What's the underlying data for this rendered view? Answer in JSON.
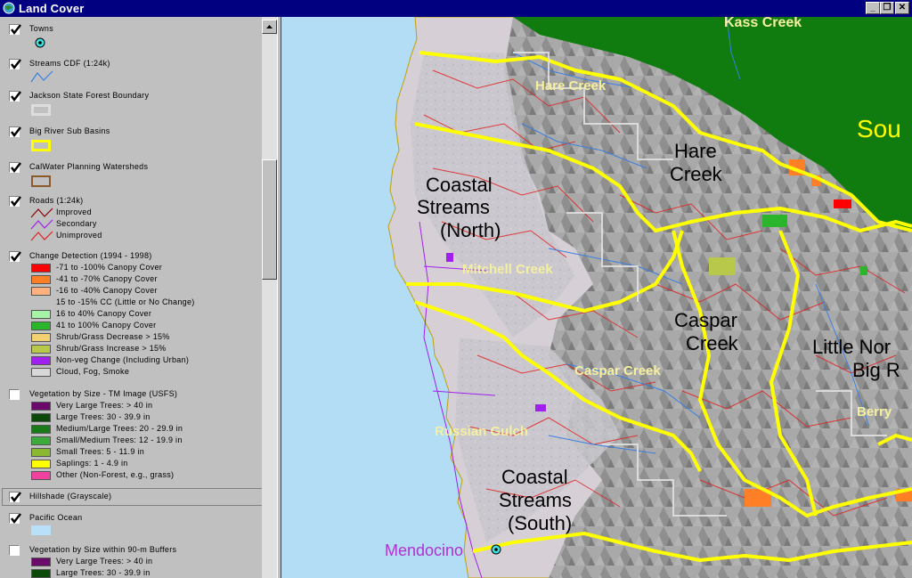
{
  "window": {
    "title": "Land Cover"
  },
  "toc": {
    "towns": {
      "name": "Towns"
    },
    "streams": {
      "name": "Streams CDF (1:24k)"
    },
    "jackson": {
      "name": "Jackson State Forest Boundary"
    },
    "bigriver": {
      "name": "Big River Sub Basins"
    },
    "calwater": {
      "name": "CalWater Planning Watersheds"
    },
    "roads": {
      "name": "Roads (1:24k)",
      "items": [
        "Improved",
        "Secondary",
        "Unimproved"
      ]
    },
    "change": {
      "name": "Change Detection (1994 - 1998)",
      "items": [
        {
          "label": "-71 to -100% Canopy Cover",
          "color": "#ff0000"
        },
        {
          "label": "-41 to -70% Canopy Cover",
          "color": "#ff7f27"
        },
        {
          "label": "-16 to -40% Canopy Cover",
          "color": "#ffb27f"
        },
        {
          "label": "15 to -15% CC (Little or No Change)",
          "color": ""
        },
        {
          "label": "16 to 40% Canopy Cover",
          "color": "#a6f5a6"
        },
        {
          "label": "41 to 100% Canopy Cover",
          "color": "#2bb52b"
        },
        {
          "label": "Shrub/Grass Decrease > 15%",
          "color": "#f0d070"
        },
        {
          "label": "Shrub/Grass Increase > 15%",
          "color": "#b8c84a"
        },
        {
          "label": "Non-veg Change (Including Urban)",
          "color": "#a020f0"
        },
        {
          "label": "Cloud, Fog, Smoke",
          "color": "#d8d8d8"
        }
      ]
    },
    "vegsize": {
      "name": "Vegetation by Size - TM Image (USFS)",
      "items": [
        {
          "label": "Very Large Trees: > 40  in",
          "color": "#6a0a6a"
        },
        {
          "label": "Large Trees: 30 - 39.9 in",
          "color": "#0b4a0b"
        },
        {
          "label": "Medium/Large Trees: 20 - 29.9 in",
          "color": "#1a7a1a"
        },
        {
          "label": "Small/Medium Trees: 12 - 19.9 in",
          "color": "#3cab3c"
        },
        {
          "label": "Small Trees: 5 - 11.9 in",
          "color": "#8ab830"
        },
        {
          "label": "Saplings: 1 - 4.9 in",
          "color": "#ffff00"
        },
        {
          "label": "Other (Non-Forest, e.g., grass)",
          "color": "#f040a0"
        }
      ]
    },
    "hillshade": {
      "name": "Hillshade (Grayscale)"
    },
    "ocean": {
      "name": "Pacific Ocean",
      "color": "#b8e0f8"
    },
    "vegbuf": {
      "name": "Vegetation by Size within 90-m Buffers",
      "items": [
        {
          "label": "Very Large Trees: > 40  in",
          "color": "#6a0a6a"
        },
        {
          "label": "Large Trees: 30 - 39.9 in",
          "color": "#0b4a0b"
        }
      ]
    }
  },
  "map": {
    "labels": {
      "kass": "Kass Creek",
      "south": "Sou",
      "hare_creek": "Hare Creek",
      "hare_big_1": "Hare",
      "hare_big_2": "Creek",
      "coastal_n_1": "Coastal",
      "coastal_n_2": "Streams",
      "coastal_n_3": "(North)",
      "mitchell": "Mitchell Creek",
      "caspar_1": "Caspar",
      "caspar_2": "Creek",
      "caspar_creek": "Caspar Creek",
      "little_1": "Little Nor",
      "little_2": "Big R",
      "berry": "Berry",
      "russian": "Russian Gulch",
      "coastal_s_1": "Coastal",
      "coastal_s_2": "Streams",
      "coastal_s_3": "(South)",
      "mendocino": "Mendocino"
    },
    "colors": {
      "ocean": "#b2ddf4",
      "forest_green": "#107c10",
      "basin_boundary": "#ffff00",
      "roads": "#e02020",
      "streams": "#3a7fe0"
    }
  }
}
